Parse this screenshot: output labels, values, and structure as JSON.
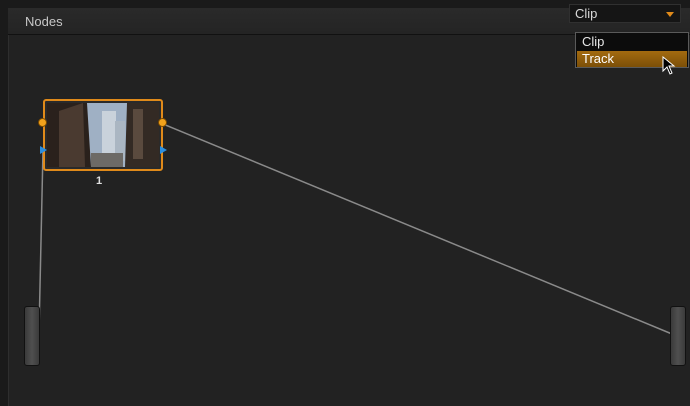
{
  "panel": {
    "title": "Nodes"
  },
  "mode_select": {
    "value": "Clip",
    "options": [
      "Clip",
      "Track"
    ],
    "highlighted": "Track"
  },
  "node": {
    "label": "1"
  },
  "colors": {
    "accent": "#e08a1a",
    "input_arrow": "#2a8ee0",
    "wire": "#8a8a8a"
  },
  "icons": {
    "cursor": "pointer-cursor-icon",
    "dropdown": "dropdown-arrow-icon"
  }
}
